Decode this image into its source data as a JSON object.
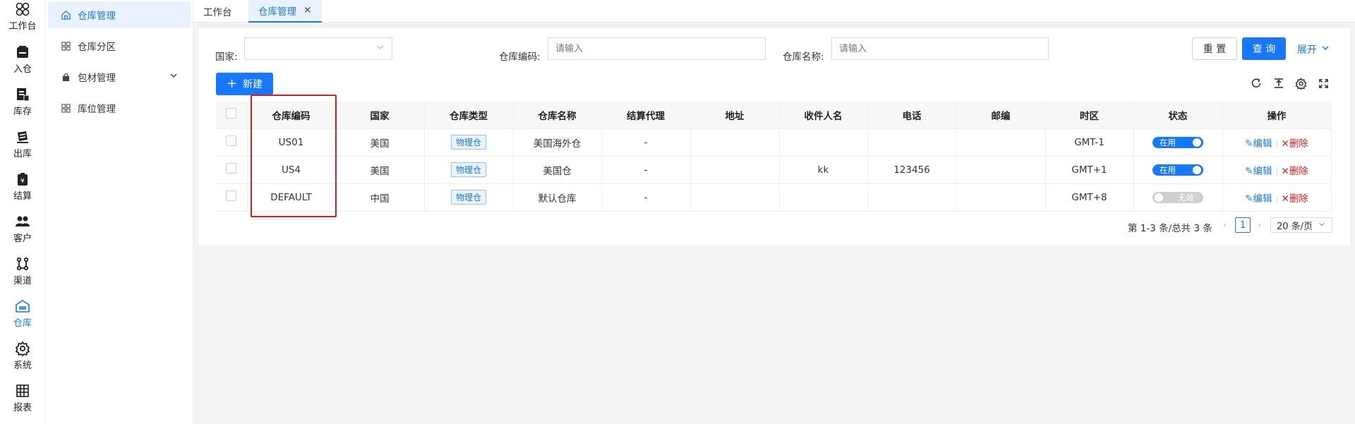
{
  "rail": [
    {
      "label": "工作台",
      "icon": "dashboard-icon"
    },
    {
      "label": "入仓",
      "icon": "inbound-icon"
    },
    {
      "label": "库存",
      "icon": "inventory-icon"
    },
    {
      "label": "出库",
      "icon": "outbound-icon"
    },
    {
      "label": "结算",
      "icon": "settlement-icon"
    },
    {
      "label": "客户",
      "icon": "customers-icon"
    },
    {
      "label": "渠道",
      "icon": "channel-icon"
    },
    {
      "label": "仓库",
      "icon": "warehouse-icon"
    },
    {
      "label": "系统",
      "icon": "settings-icon"
    },
    {
      "label": "报表",
      "icon": "report-icon"
    }
  ],
  "submenu": [
    {
      "label": "仓库管理"
    },
    {
      "label": "仓库分区"
    },
    {
      "label": "包材管理"
    },
    {
      "label": "库位管理"
    }
  ],
  "tabs": [
    {
      "label": "工作台"
    },
    {
      "label": "仓库管理",
      "close": "✕"
    }
  ],
  "filters": {
    "country_label": "国家:",
    "code_label": "仓库编码:",
    "code_placeholder": "请输入",
    "name_label": "仓库名称:",
    "name_placeholder": "请输入",
    "reset": "重 置",
    "query": "查 询",
    "expand": "展开"
  },
  "toolbar": {
    "new": "新建"
  },
  "table": {
    "headers": [
      "仓库编码",
      "国家",
      "仓库类型",
      "仓库名称",
      "结算代理",
      "地址",
      "收件人名",
      "电话",
      "邮编",
      "时区",
      "状态",
      "操作"
    ],
    "rows": [
      {
        "code": "US01",
        "country": "美国",
        "type": "物理仓",
        "name": "美国海外仓",
        "agent": "-",
        "address": "",
        "recipient": "",
        "phone": "",
        "zip": "",
        "tz": "GMT-1",
        "status": "在用",
        "status_on": true
      },
      {
        "code": "US4",
        "country": "美国",
        "type": "物理仓",
        "name": "美国仓",
        "agent": "-",
        "address": "",
        "recipient": "kk",
        "phone": "123456",
        "zip": "",
        "tz": "GMT+1",
        "status": "在用",
        "status_on": true
      },
      {
        "code": "DEFAULT",
        "country": "中国",
        "type": "物理仓",
        "name": "默认仓库",
        "agent": "-",
        "address": "",
        "recipient": "",
        "phone": "",
        "zip": "",
        "tz": "GMT+8",
        "status": "无效",
        "status_on": false
      }
    ],
    "edit": "编辑",
    "delete": "删除"
  },
  "pagination": {
    "summary": "第 1-3 条/总共 3 条",
    "current": "1",
    "page_size": "20 条/页"
  },
  "colors": {
    "primary": "#1677ff",
    "danger": "#e02020",
    "highlight": "#e21b1b"
  }
}
